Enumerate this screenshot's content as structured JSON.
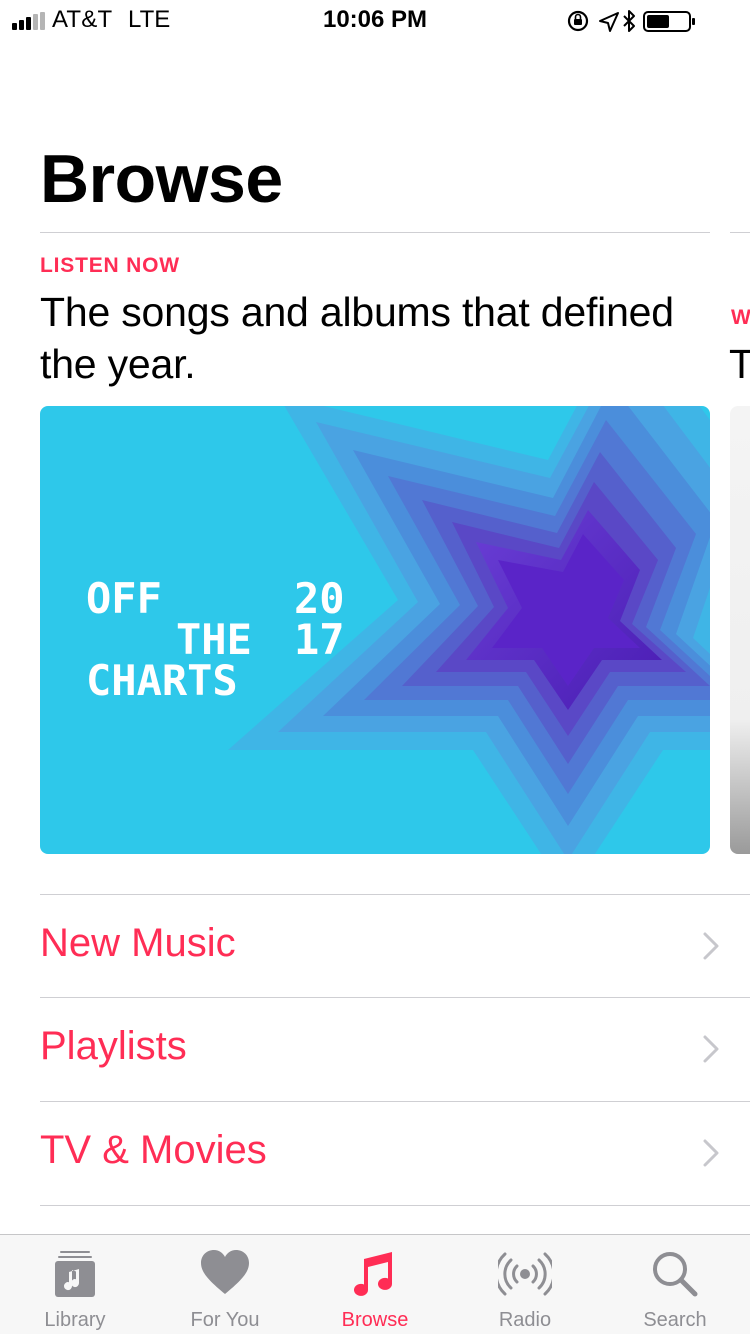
{
  "status_bar": {
    "carrier": "AT&T",
    "network": "LTE",
    "time": "10:06 PM",
    "icons": [
      "signal-bars",
      "orientation-lock-icon",
      "location-icon",
      "bluetooth-icon",
      "battery-icon"
    ]
  },
  "page": {
    "title": "Browse"
  },
  "featured": {
    "label": "LISTEN NOW",
    "headline": "The songs and albums that defined the year.",
    "artwork": {
      "line1": "OFF",
      "line2": "THE",
      "line3": "CHARTS",
      "year_top": "20",
      "year_bottom": "17"
    },
    "next_label": "W",
    "next_headline": "T"
  },
  "browse_list": [
    {
      "label": "New Music"
    },
    {
      "label": "Playlists"
    },
    {
      "label": "TV & Movies"
    }
  ],
  "tab_bar": {
    "tabs": [
      {
        "label": "Library",
        "icon": "library-icon"
      },
      {
        "label": "For You",
        "icon": "heart-icon"
      },
      {
        "label": "Browse",
        "icon": "music-note-icon"
      },
      {
        "label": "Radio",
        "icon": "radio-icon"
      },
      {
        "label": "Search",
        "icon": "search-icon"
      }
    ],
    "active": "Browse"
  },
  "colors": {
    "accent": "#ff2d55",
    "inactive_tab": "#8e8e93",
    "artwork_cyan": "#2ec8ea",
    "artwork_purple": "#5a24c8"
  }
}
